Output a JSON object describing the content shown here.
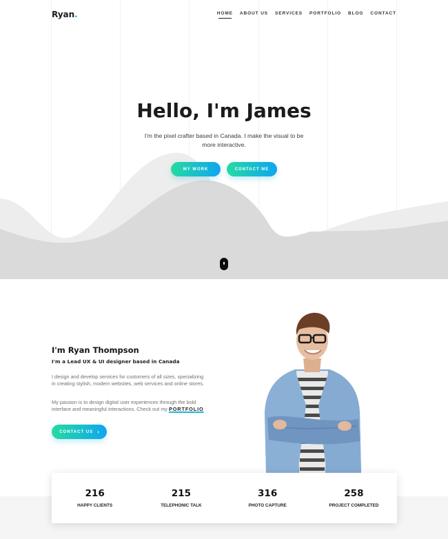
{
  "header": {
    "logo_text": "Ryan",
    "logo_dot": ".",
    "nav": [
      "HOME",
      "ABOUT US",
      "SERVICES",
      "PORTFOLIO",
      "BLOG",
      "CONTACT"
    ],
    "active_nav": "HOME"
  },
  "hero": {
    "title": "Hello, I'm James",
    "subtitle": "I'm the pixel crafter based in Canada. I make the visual to be more interactive.",
    "btn_work": "MY WORK",
    "btn_contact": "CONTACT ME",
    "scroll_icon": "mouse-scroll-icon"
  },
  "about": {
    "title": "I'm Ryan Thompson",
    "subtitle": "I'm a Lead UX & UI designer based in Canada",
    "p1": "I design and develop services for customers of all sizes, specializing in creating stylish, modern websites, web services and online stores.",
    "p2_text": "My passion is to design digital user experiences through the bold interface and meaningful interactions. Check out my",
    "p2_link": "PORTFOLIO",
    "btn": "CONTACT US",
    "btn_icon": "chevron-right-icon"
  },
  "stats": [
    {
      "number": "216",
      "label": "HAPPY CLIENTS"
    },
    {
      "number": "215",
      "label": "TELEPHONIC TALK"
    },
    {
      "number": "316",
      "label": "PHOTO CAPTURE"
    },
    {
      "number": "258",
      "label": "PROJECT COMPLETED"
    }
  ],
  "colors": {
    "accent_start": "#25dba0",
    "accent_end": "#0fa5f1",
    "wave_light": "#ececec",
    "wave_dark": "#dadada"
  }
}
